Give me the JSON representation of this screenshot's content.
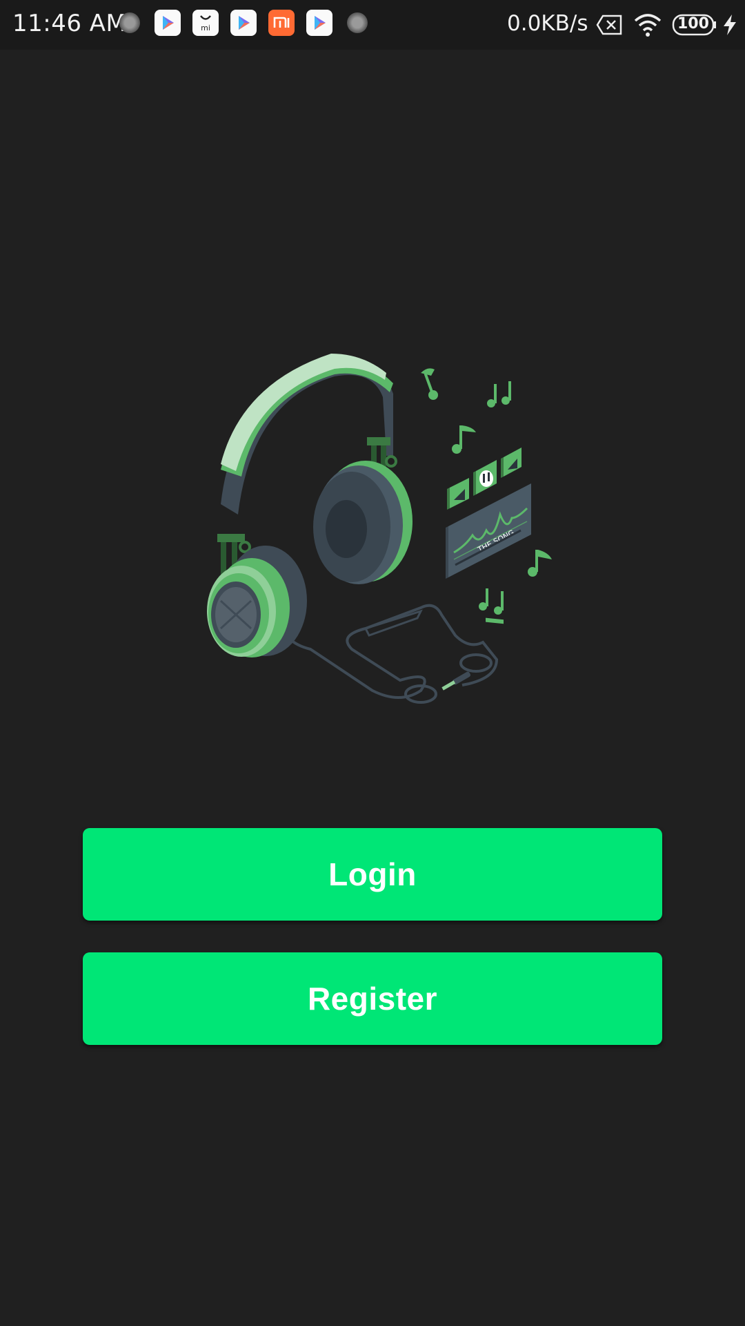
{
  "status_bar": {
    "time": "11:46 AM",
    "network_speed": "0.0KB/s",
    "battery_level": "100",
    "notification_icons": [
      "loading-icon",
      "play-store-icon",
      "mi-store-icon",
      "play-store-icon",
      "mi-icon",
      "play-store-icon",
      "loading-icon"
    ],
    "mi_label": "mi"
  },
  "illustration": {
    "icon": "headphones-music-illustration-icon",
    "player_screen_text": "THE SONG",
    "accent_color": "#5cb96a"
  },
  "actions": {
    "login_label": "Login",
    "register_label": "Register",
    "button_color": "#00e676"
  },
  "colors": {
    "background": "#202020",
    "status_bar": "#1a1a1a"
  }
}
